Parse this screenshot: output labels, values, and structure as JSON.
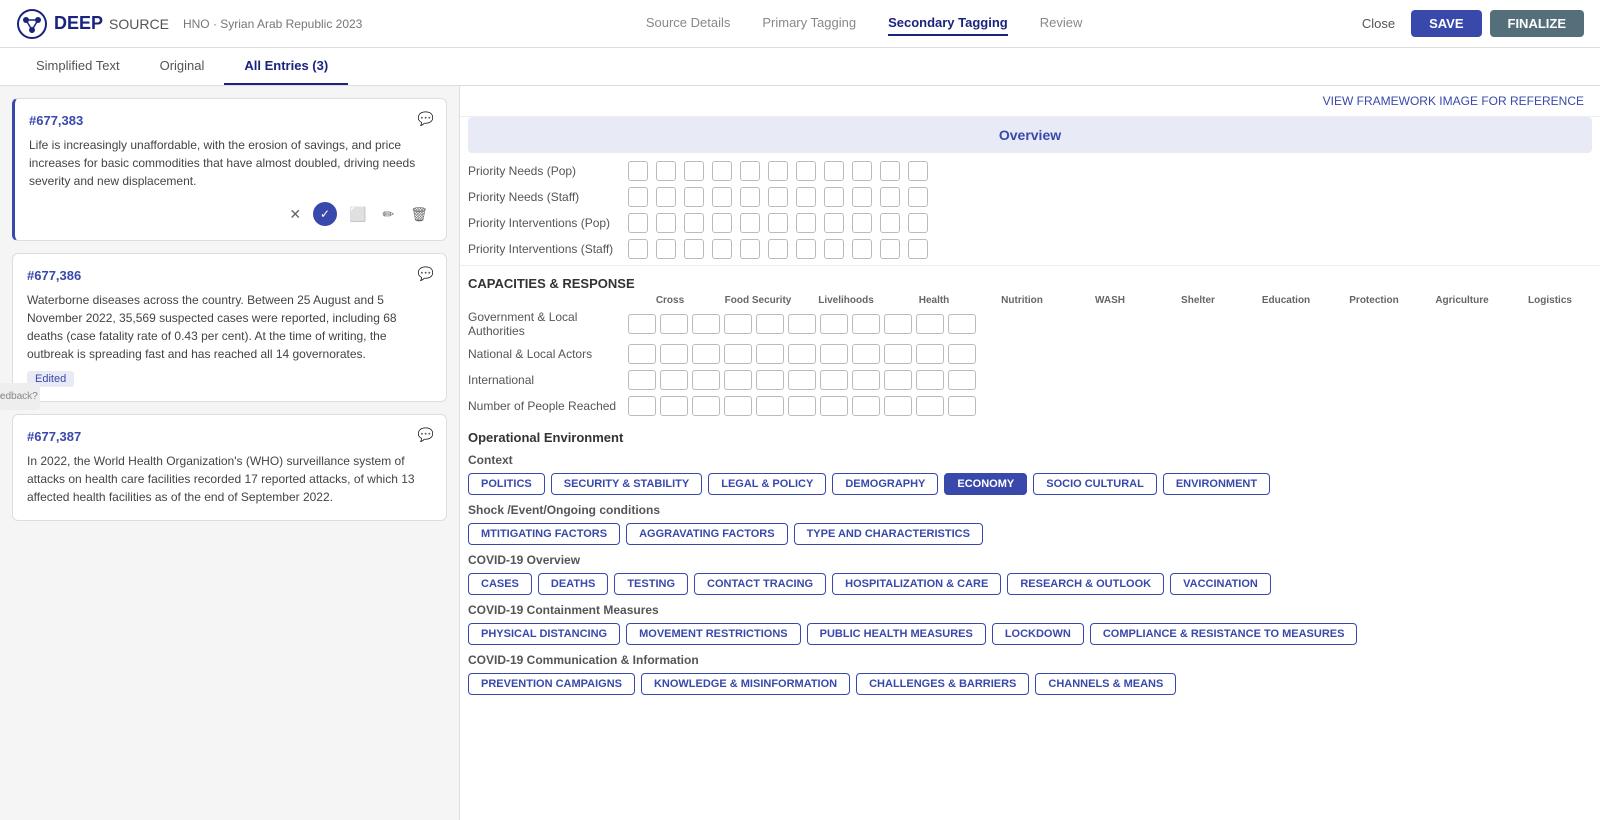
{
  "header": {
    "logo_text": "DEEP",
    "logo_suffix": "SOURCE",
    "project": "HNO · Syrian Arab Republic 2023",
    "nav_tabs": [
      {
        "label": "Source Details",
        "active": false
      },
      {
        "label": "Primary Tagging",
        "active": false
      },
      {
        "label": "Secondary Tagging",
        "active": true
      },
      {
        "label": "Review",
        "active": false
      }
    ],
    "close_label": "Close",
    "save_label": "SAVE",
    "finalize_label": "FINALIZE"
  },
  "sub_tabs": [
    {
      "label": "Simplified Text",
      "active": false
    },
    {
      "label": "Original",
      "active": false
    },
    {
      "label": "All Entries (3)",
      "active": true
    }
  ],
  "view_framework_link": "VIEW FRAMEWORK IMAGE FOR REFERENCE",
  "entries": [
    {
      "id": "#677,383",
      "text": "Life is increasingly unaffordable, with the erosion of savings, and price increases for basic commodities that have almost doubled, driving needs severity and new displacement.",
      "active": true,
      "badge": null
    },
    {
      "id": "#677,386",
      "text": "Waterborne diseases across the country. Between 25 August and 5 November 2022, 35,569 suspected cases were reported, including 68 deaths (case fatality rate of 0.43 per cent). At the time of writing, the outbreak is spreading fast and has reached all 14 governorates.",
      "active": false,
      "badge": "Edited"
    },
    {
      "id": "#677,387",
      "text": "In 2022, the World Health Organization's (WHO) surveillance system of attacks on health care facilities recorded 17 reported attacks, of which 13 affected health facilities as of the end of September 2022.",
      "active": false,
      "badge": null
    }
  ],
  "overview_label": "Overview",
  "priority_rows": [
    {
      "label": "Priority Needs (Pop)",
      "cols": 11
    },
    {
      "label": "Priority Needs (Staff)",
      "cols": 11
    },
    {
      "label": "Priority Interventions (Pop)",
      "cols": 11
    },
    {
      "label": "Priority Interventions (Staff)",
      "cols": 11
    }
  ],
  "capacities_title": "CAPACITIES & RESPONSE",
  "cap_columns": [
    "Cross",
    "Food Security",
    "Livelihoods",
    "Health",
    "Nutrition",
    "WASH",
    "Shelter",
    "Education",
    "Protection",
    "Agriculture",
    "Logistics"
  ],
  "cap_rows": [
    {
      "label": "Government & Local Authorities"
    },
    {
      "label": "National & Local Actors"
    },
    {
      "label": "International"
    },
    {
      "label": "Number of People Reached"
    }
  ],
  "operational_env": {
    "title": "Operational Environment",
    "context_label": "Context",
    "context_tags": [
      {
        "label": "POLITICS",
        "active": false
      },
      {
        "label": "SECURITY & STABILITY",
        "active": false
      },
      {
        "label": "LEGAL & POLICY",
        "active": false
      },
      {
        "label": "DEMOGRAPHY",
        "active": false
      },
      {
        "label": "ECONOMY",
        "active": true
      },
      {
        "label": "SOCIO CULTURAL",
        "active": false
      },
      {
        "label": "ENVIRONMENT",
        "active": false
      }
    ],
    "shock_label": "Shock /Event/Ongoing conditions",
    "shock_tags": [
      {
        "label": "MTITIGATING FACTORS",
        "active": false
      },
      {
        "label": "AGGRAVATING FACTORS",
        "active": false
      },
      {
        "label": "TYPE AND CHARACTERISTICS",
        "active": false
      }
    ],
    "covid_overview_label": "COVID-19 Overview",
    "covid_overview_tags": [
      {
        "label": "CASES",
        "active": false
      },
      {
        "label": "DEATHS",
        "active": false
      },
      {
        "label": "TESTING",
        "active": false
      },
      {
        "label": "CONTACT TRACING",
        "active": false
      },
      {
        "label": "HOSPITALIZATION & CARE",
        "active": false
      },
      {
        "label": "RESEARCH & OUTLOOK",
        "active": false
      },
      {
        "label": "VACCINATION",
        "active": false
      }
    ],
    "covid_containment_label": "COVID-19 Containment Measures",
    "covid_containment_tags": [
      {
        "label": "PHYSICAL DISTANCING",
        "active": false
      },
      {
        "label": "MOVEMENT RESTRICTIONS",
        "active": false
      },
      {
        "label": "PUBLIC HEALTH MEASURES",
        "active": false
      },
      {
        "label": "LOCKDOWN",
        "active": false
      },
      {
        "label": "COMPLIANCE & RESISTANCE TO MEASURES",
        "active": false
      }
    ],
    "covid_comms_label": "COVID-19 Communication & Information",
    "covid_comms_tags": [
      {
        "label": "PREVENTION CAMPAIGNS",
        "active": false
      },
      {
        "label": "KNOWLEDGE & MISINFORMATION",
        "active": false
      },
      {
        "label": "CHALLENGES & BARRIERS",
        "active": false
      },
      {
        "label": "CHANNELS & MEANS",
        "active": false
      }
    ]
  }
}
